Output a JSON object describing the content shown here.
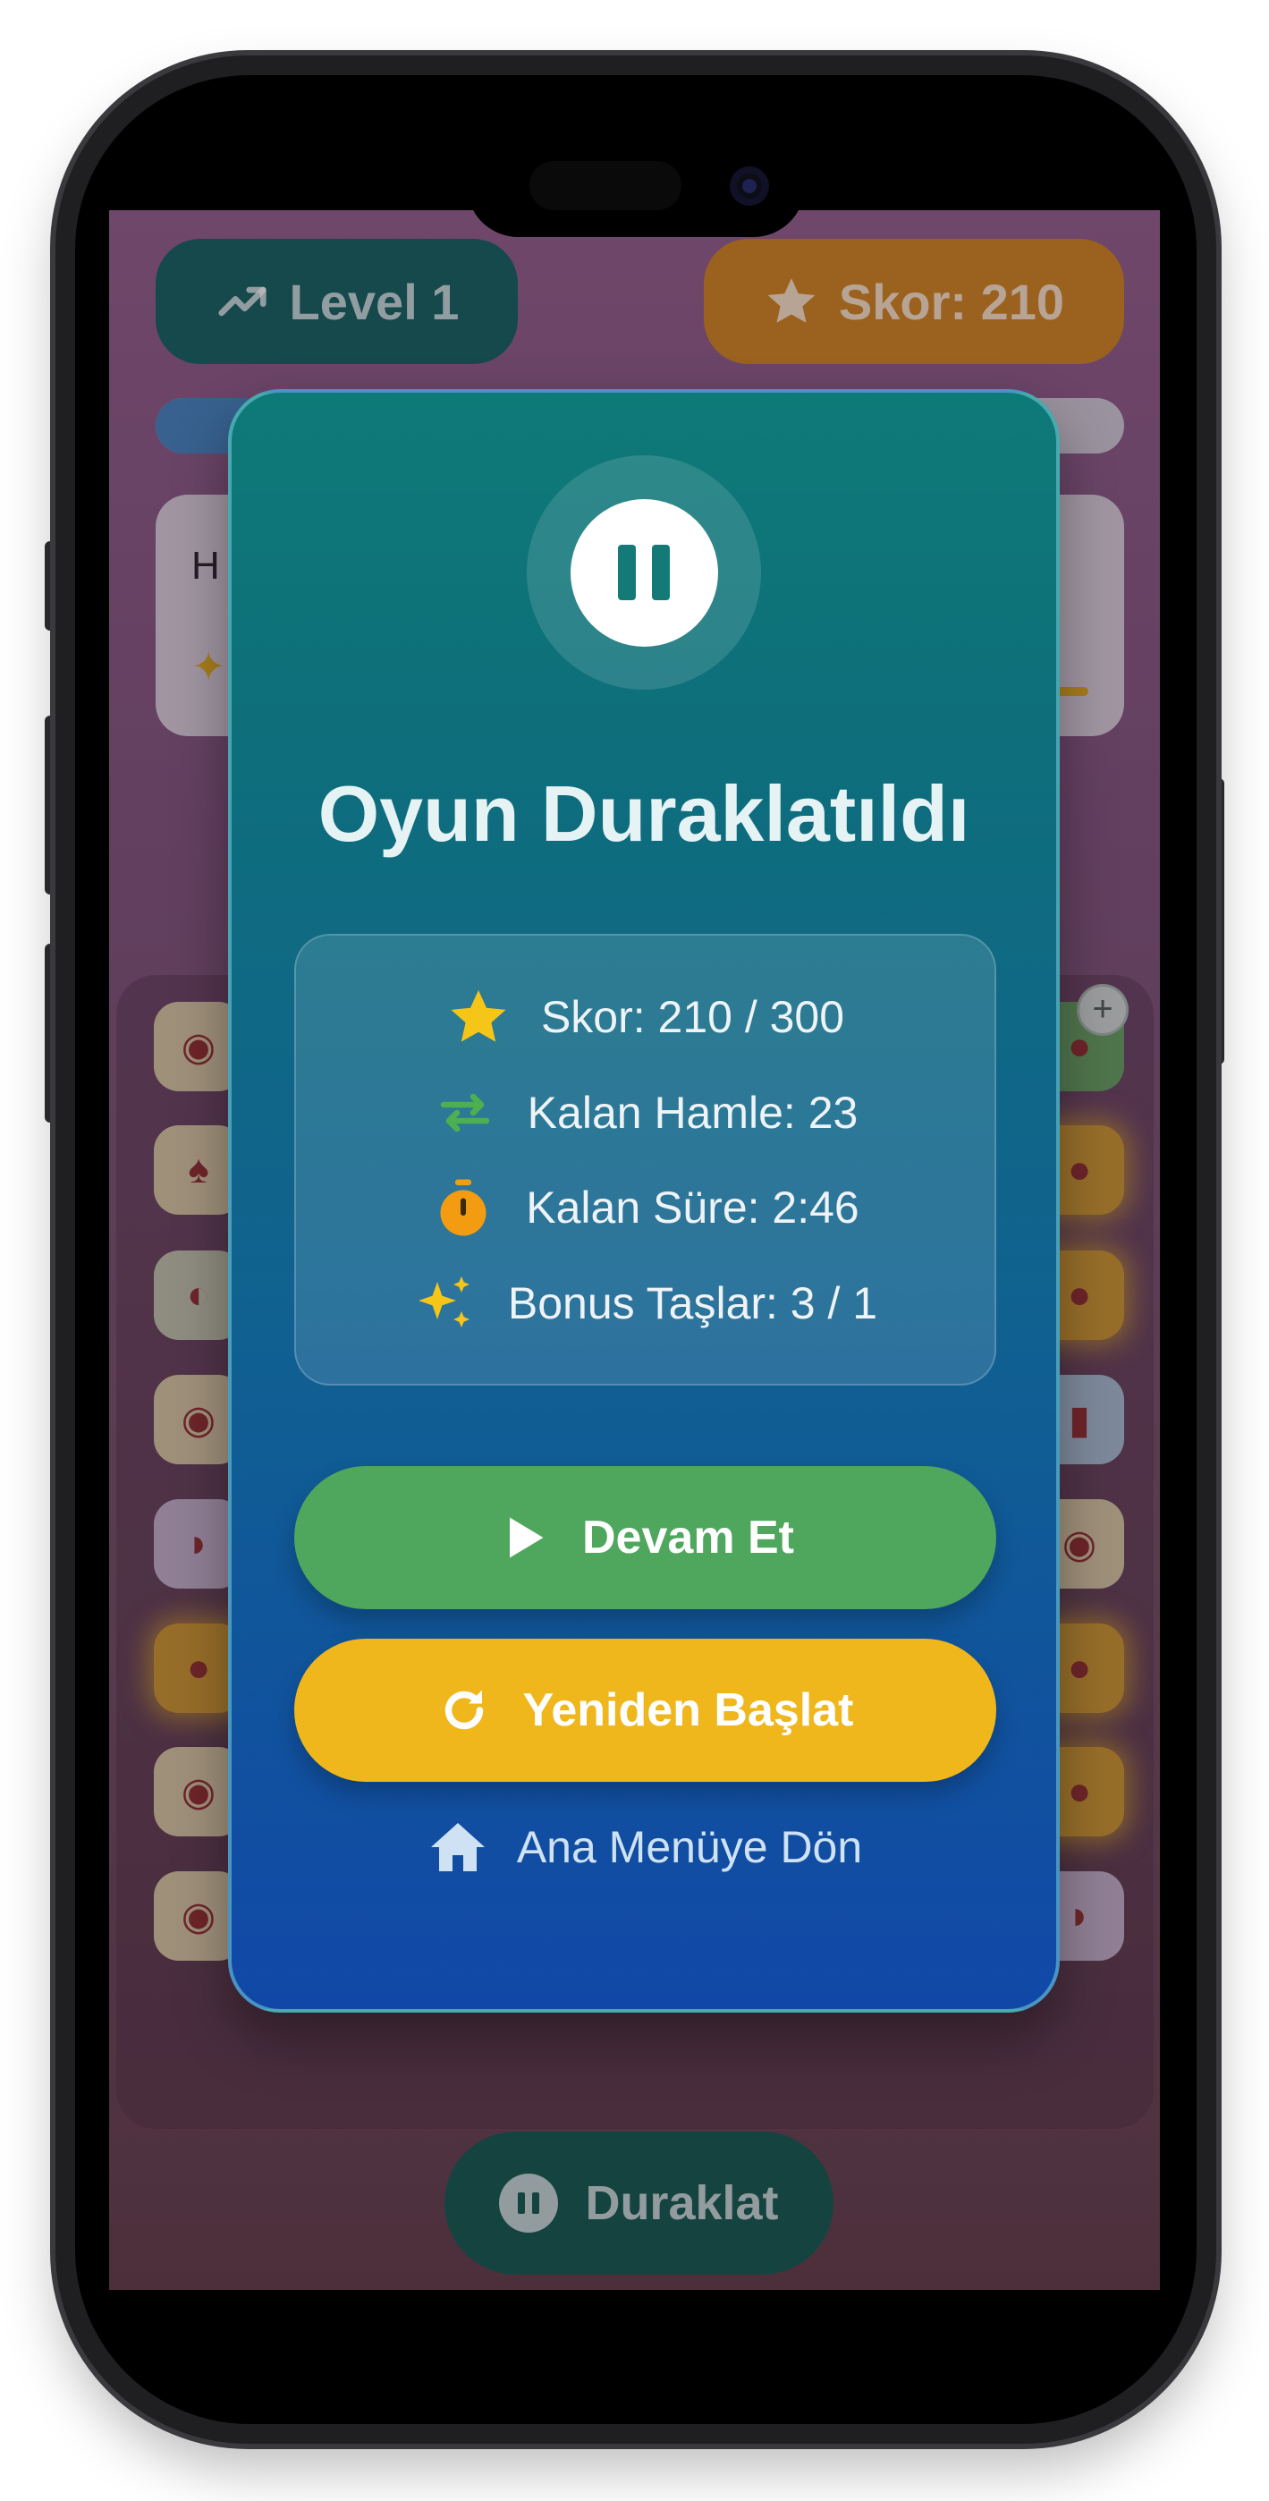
{
  "header": {
    "level_label": "Level 1",
    "score_label": "Skor: 210"
  },
  "task_card": {
    "title_fragment": "H"
  },
  "progress": {
    "fraction": 0.14
  },
  "pause_button_label": "Duraklat",
  "pause_modal": {
    "title": "Oyun Duraklatıldı",
    "stats": [
      {
        "icon": "star-icon",
        "text": "Skor: 210 / 300"
      },
      {
        "icon": "swap-arrows-icon",
        "text": "Kalan Hamle: 23"
      },
      {
        "icon": "stopwatch-icon",
        "text": "Kalan Süre: 2:46"
      },
      {
        "icon": "sparkles-icon",
        "text": "Bonus Taşlar: 3 / 1"
      }
    ],
    "continue_label": "Devam Et",
    "restart_label": "Yeniden Başlat",
    "main_menu_label": "Ana Menüye Dön"
  },
  "colors": {
    "modal_top": "#0e7a78",
    "modal_bottom": "#1148a8",
    "continue": "#4ea75c",
    "restart": "#efb71c",
    "star": "#f5c518",
    "swap": "#4caf50",
    "stopwatch": "#f39c12"
  }
}
